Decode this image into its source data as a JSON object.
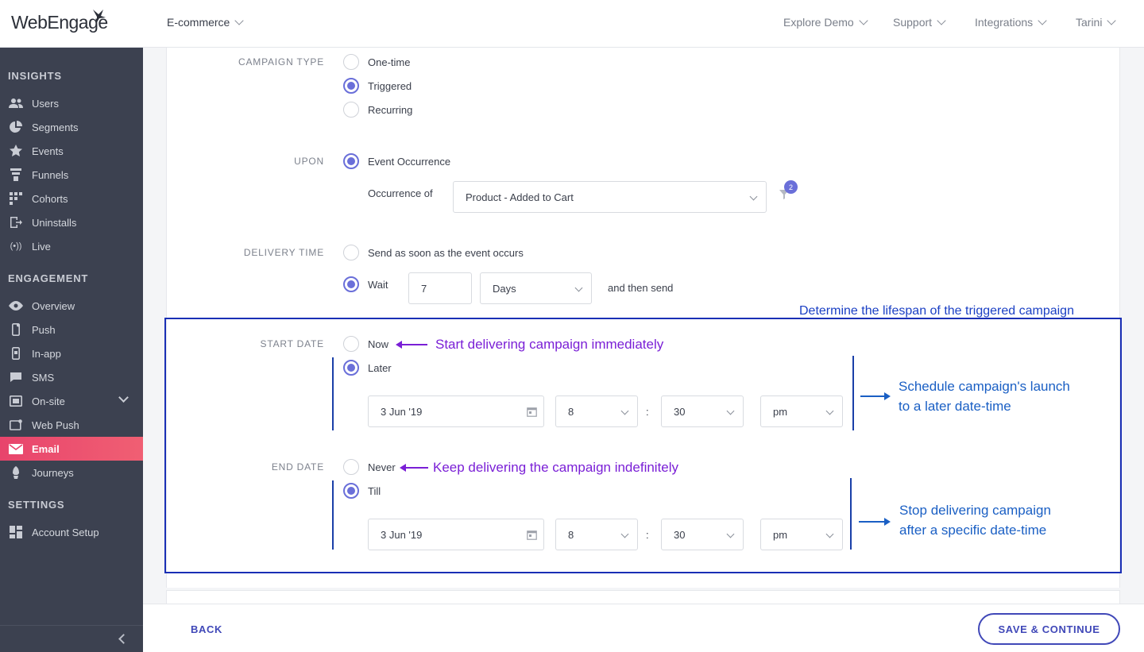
{
  "header": {
    "logo_text": "WebEngage",
    "project": "E-commerce",
    "nav": [
      "Explore Demo",
      "Support",
      "Integrations",
      "Tarini"
    ]
  },
  "sidebar": {
    "insights_title": "INSIGHTS",
    "insights": [
      "Users",
      "Segments",
      "Events",
      "Funnels",
      "Cohorts",
      "Uninstalls",
      "Live"
    ],
    "engagement_title": "ENGAGEMENT",
    "engagement": [
      "Overview",
      "Push",
      "In-app",
      "SMS",
      "On-site",
      "Web Push",
      "Email",
      "Journeys"
    ],
    "settings_title": "SETTINGS",
    "settings": [
      "Account Setup"
    ],
    "active": "Email"
  },
  "form": {
    "campaign_type": {
      "label": "CAMPAIGN TYPE",
      "options": [
        "One-time",
        "Triggered",
        "Recurring"
      ],
      "selected": "Triggered"
    },
    "upon": {
      "label": "UPON",
      "option": "Event Occurrence",
      "occurrence_label": "Occurrence of",
      "event": "Product - Added to Cart",
      "filter_count": "2"
    },
    "delivery_time": {
      "label": "DELIVERY TIME",
      "option_now": "Send as soon as the event occurs",
      "option_wait": "Wait",
      "wait_value": "7",
      "wait_unit": "Days",
      "suffix": "and then send"
    },
    "start_date": {
      "label": "START DATE",
      "option_now": "Now",
      "option_later": "Later",
      "date": "3 Jun '19",
      "hour": "8",
      "minute": "30",
      "ampm": "pm",
      "separator": ":"
    },
    "end_date": {
      "label": "END DATE",
      "option_never": "Never",
      "option_till": "Till",
      "date": "3 Jun '19",
      "hour": "8",
      "minute": "30",
      "ampm": "pm",
      "separator": ":"
    }
  },
  "annotations": {
    "title": "Determine the lifespan of the triggered campaign",
    "now": "Start delivering campaign immediately",
    "later_line1": "Schedule campaign's launch",
    "later_line2": "to a later date-time",
    "never": "Keep delivering the campaign indefinitely",
    "till_line1": "Stop delivering campaign",
    "till_line2": "after a specific date-time",
    "colors": {
      "box": "#1a2fb5",
      "purple": "#7a1fd6",
      "blue": "#1a5fc4"
    }
  },
  "footer": {
    "back": "BACK",
    "save": "SAVE & CONTINUE"
  },
  "colors": {
    "accent": "#6a6fd9",
    "sidebar": "#3c4150",
    "active": "#e8446c",
    "button": "#4048b8"
  }
}
